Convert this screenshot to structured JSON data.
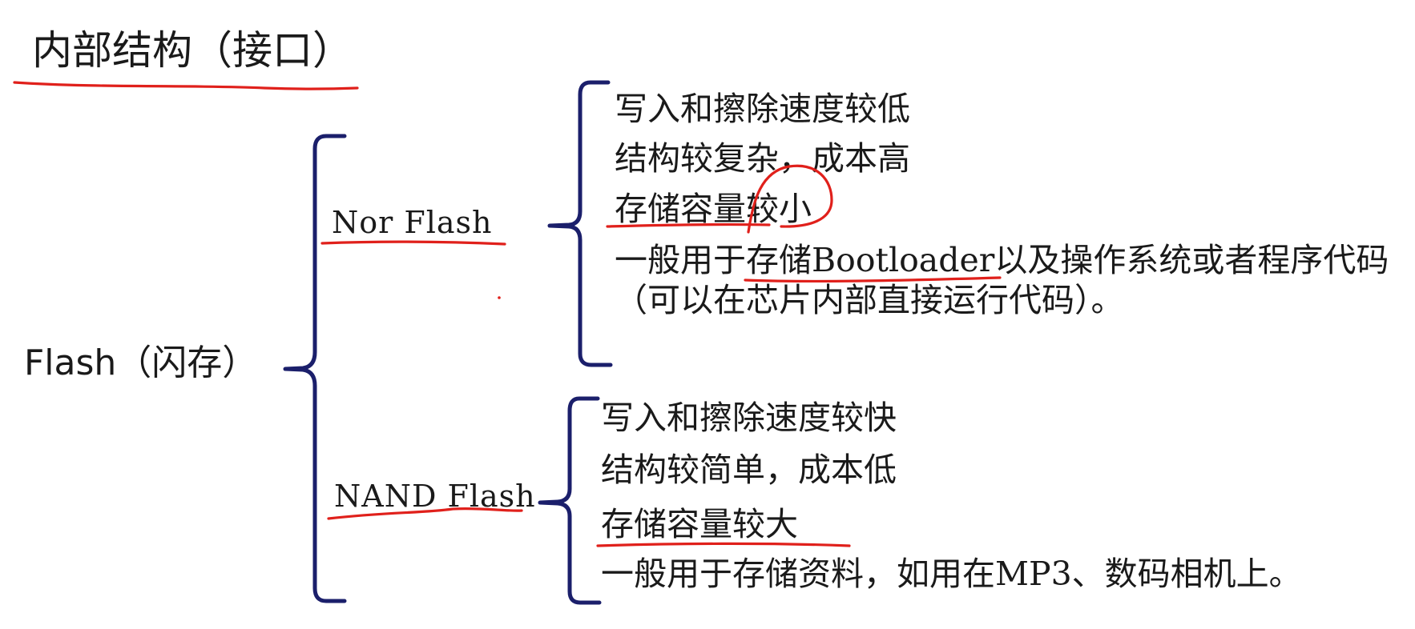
{
  "title": "内部结构（接口）",
  "root": {
    "label": "Flash（闪存）"
  },
  "branches": {
    "nor": {
      "label": "Nor Flash",
      "items": [
        "写入和擦除速度较低",
        "结构较复杂，成本高",
        "存储容量较小"
      ],
      "usage": {
        "prefix": "一般用于存储",
        "term": "Bootloader",
        "suffix": "以及操作系统或者程序代码",
        "line2": "（可以在芯片内部直接运行代码）。"
      }
    },
    "nand": {
      "label": "NAND Flash",
      "items": [
        "写入和擦除速度较快",
        "结构较简单，成本低",
        "存储容量较大"
      ],
      "usage": {
        "prefix": "一般用于存储资料，如用在",
        "term": "MP3",
        "suffix": "、数码相机上。"
      }
    }
  },
  "colors": {
    "text": "#1a1a1a",
    "brace": "#1b1f6b",
    "annotation": "#e0201b"
  }
}
